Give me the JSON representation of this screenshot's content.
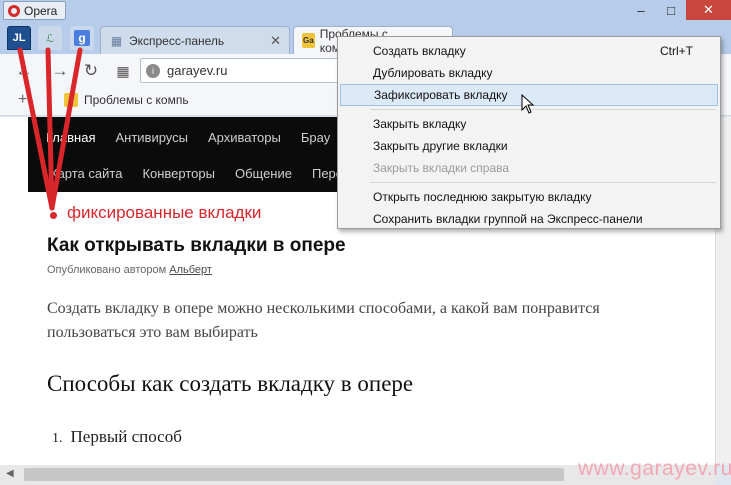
{
  "titlebar": {
    "app": "Opera"
  },
  "tabs": {
    "pinned": [
      {
        "label": "JL"
      },
      {
        "label": "ℒ"
      },
      {
        "label": "g"
      }
    ],
    "express": {
      "title": "Экспресс-панель"
    },
    "active": {
      "title": "Проблемы с компьютером"
    }
  },
  "address": {
    "url": "garayev.ru"
  },
  "bookmarks": {
    "item": "Проблемы с компь"
  },
  "site": {
    "nav_row1": [
      "Главная",
      "Антивирусы",
      "Архиваторы",
      "Брау"
    ],
    "nav_row2": [
      "Карта сайта",
      "Конверторы",
      "Общение",
      "Пере"
    ]
  },
  "annotation": "фиксированные вкладки",
  "article": {
    "title": "Как открывать вкладки в опере",
    "byline_prefix": "Опубликовано автором",
    "author": "Альберт",
    "intro": "Создать вкладку в опере можно несколькими способами, а какой вам понравится пользоваться это вам выбирать",
    "heading": "Способы как создать вкладку в опере",
    "list_number": "1.",
    "list_item": "Первый способ"
  },
  "context_menu": {
    "items": [
      {
        "label": "Создать вкладку",
        "shortcut": "Ctrl+T"
      },
      {
        "label": "Дублировать вкладку"
      },
      {
        "label": "Зафиксировать вкладку",
        "state": "hover"
      },
      {
        "label": "Закрыть вкладку"
      },
      {
        "label": "Закрыть другие вкладки"
      },
      {
        "label": "Закрыть вкладки справа",
        "state": "disabled"
      },
      {
        "label": "Открыть последнюю закрытую вкладку"
      },
      {
        "label": "Сохранить вкладки группой на Экспресс-панели"
      }
    ]
  },
  "watermark": "www.garayev.ru",
  "colors": {
    "annotation": "#d9262a",
    "titlebar": "#b6ccea",
    "site_nav": "#0b0b0b"
  },
  "icons": [
    "opera-logo-icon",
    "minimize-icon",
    "maximize-icon",
    "close-icon",
    "back-icon",
    "forward-icon",
    "reload-icon",
    "speed-dial-icon",
    "site-info-icon",
    "add-bookmark-icon",
    "mouse-cursor-icon"
  ]
}
